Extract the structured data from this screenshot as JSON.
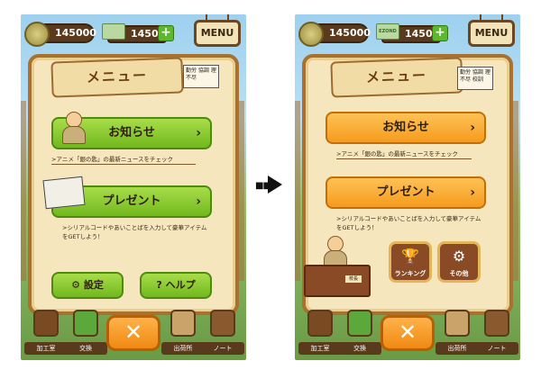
{
  "coins": "145000",
  "cash": "1450",
  "cash_icon_text": "EZOND",
  "plus": "+",
  "menu_button": "MENU",
  "panel_title": "メニュー",
  "note_text": "勤労 協調 理不尽",
  "note_text_right": "勤労 協調 理不尽 校訓",
  "news_button": "お知らせ",
  "news_caption": ">アニメ「銀の匙」の最新ニュースをチェック",
  "present_button": "プレゼント",
  "present_caption": ">シリアルコードやあいことばを入力して豪華アイテムをGETしよう！",
  "settings_button": "設定",
  "help_button": "ヘルプ",
  "ranking_button": "ランキング",
  "other_button": "その他",
  "nameplate": "校長",
  "chevron": "›",
  "close": "✕",
  "icons": {
    "coin": "coin-icon",
    "gear": "gear-icon",
    "help": "question-icon",
    "trophy": "trophy-icon",
    "other": "gear-icon"
  },
  "bottom_nav": {
    "left": [
      "加工室",
      "交換",
      "出荷所",
      "ノート"
    ],
    "right": [
      "加工室",
      "交換",
      "出荷所",
      "ノート"
    ]
  },
  "colors": {
    "green_button": "#8ccc34",
    "orange_button": "#f8a92c",
    "panel": "#f6e6bd",
    "wood": "#a8712f"
  }
}
